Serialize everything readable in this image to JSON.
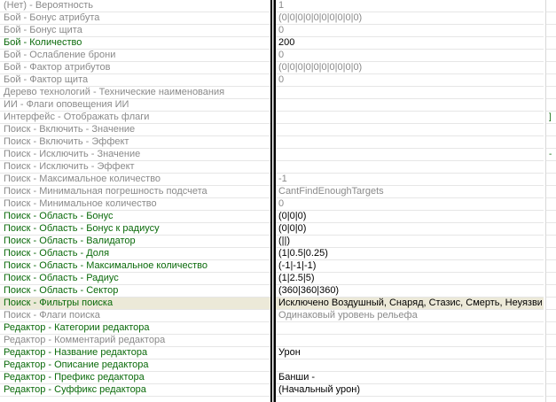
{
  "properties": [
    {
      "name": "(Нет) - Вероятность",
      "value": "1",
      "name_style": "gray",
      "value_style": "gray"
    },
    {
      "name": "Бой - Бонус атрибута",
      "value": "(0|0|0|0|0|0|0|0|0|0)",
      "name_style": "gray",
      "value_style": "gray"
    },
    {
      "name": "Бой - Бонус щита",
      "value": "0",
      "name_style": "gray",
      "value_style": "gray"
    },
    {
      "name": "Бой - Количество",
      "value": "200",
      "name_style": "green",
      "value_style": "black"
    },
    {
      "name": "Бой - Ослабление брони",
      "value": "0",
      "name_style": "gray",
      "value_style": "gray"
    },
    {
      "name": "Бой - Фактор атрибутов",
      "value": "(0|0|0|0|0|0|0|0|0|0)",
      "name_style": "gray",
      "value_style": "gray"
    },
    {
      "name": "Бой - Фактор щита",
      "value": "0",
      "name_style": "gray",
      "value_style": "gray"
    },
    {
      "name": "Дерево технологий - Технические наименования",
      "value": "",
      "name_style": "gray",
      "value_style": "gray"
    },
    {
      "name": "ИИ - Флаги оповещения ИИ",
      "value": "",
      "name_style": "gray",
      "value_style": "gray"
    },
    {
      "name": "Интерфейс - Отображать флаги",
      "value": "",
      "name_style": "gray",
      "value_style": "gray"
    },
    {
      "name": "Поиск - Включить - Значение",
      "value": "",
      "name_style": "gray",
      "value_style": "gray"
    },
    {
      "name": "Поиск - Включить - Эффект",
      "value": "",
      "name_style": "gray",
      "value_style": "gray"
    },
    {
      "name": "Поиск - Исключить - Значение",
      "value": "",
      "name_style": "gray",
      "value_style": "gray"
    },
    {
      "name": "Поиск - Исключить - Эффект",
      "value": "",
      "name_style": "gray",
      "value_style": "gray"
    },
    {
      "name": "Поиск - Максимальное количество",
      "value": "-1",
      "name_style": "gray",
      "value_style": "gray"
    },
    {
      "name": "Поиск - Минимальная погрешность подсчета",
      "value": "CantFindEnoughTargets",
      "name_style": "gray",
      "value_style": "gray"
    },
    {
      "name": "Поиск - Минимальное количество",
      "value": "0",
      "name_style": "gray",
      "value_style": "gray"
    },
    {
      "name": "Поиск - Область - Бонус",
      "value": "(0|0|0)",
      "name_style": "green",
      "value_style": "black"
    },
    {
      "name": "Поиск - Область - Бонус к радиусу",
      "value": "(0|0|0)",
      "name_style": "green",
      "value_style": "black"
    },
    {
      "name": "Поиск - Область - Валидатор",
      "value": "(||)",
      "name_style": "green",
      "value_style": "black"
    },
    {
      "name": "Поиск - Область - Доля",
      "value": "(1|0.5|0.25)",
      "name_style": "green",
      "value_style": "black"
    },
    {
      "name": "Поиск - Область - Максимальное количество",
      "value": "(-1|-1|-1)",
      "name_style": "green",
      "value_style": "black"
    },
    {
      "name": "Поиск - Область - Радиус",
      "value": "(1|2.5|5)",
      "name_style": "green",
      "value_style": "black"
    },
    {
      "name": "Поиск - Область - Сектор",
      "value": "(360|360|360)",
      "name_style": "green",
      "value_style": "black"
    },
    {
      "name": "Поиск - Фильтры поиска",
      "value": "Исключено Воздушный, Снаряд, Стазис, Смерть, Неуязви",
      "name_style": "green",
      "value_style": "black",
      "selected": true
    },
    {
      "name": "Поиск - Флаги поиска",
      "value": "Одинаковый уровень рельефа",
      "name_style": "gray",
      "value_style": "gray"
    },
    {
      "name": "Редактор - Категории редактора",
      "value": "",
      "name_style": "green",
      "value_style": "black"
    },
    {
      "name": "Редактор - Комментарий редактора",
      "value": "",
      "name_style": "gray",
      "value_style": "gray"
    },
    {
      "name": "Редактор - Название редактора",
      "value": "Урон",
      "name_style": "green",
      "value_style": "black"
    },
    {
      "name": "Редактор - Описание редактора",
      "value": "",
      "name_style": "green",
      "value_style": "black"
    },
    {
      "name": "Редактор - Префикс редактора",
      "value": "Банши -",
      "name_style": "green",
      "value_style": "black"
    },
    {
      "name": "Редактор - Суффикс редактора",
      "value": "(Начальный урон)",
      "name_style": "green",
      "value_style": "black"
    }
  ],
  "side_panel": {
    "marks": [
      {
        "row": 9,
        "text": "]"
      },
      {
        "row": 12,
        "text": "-"
      }
    ]
  },
  "colors": {
    "modified_name": "#0a6a0a",
    "default_text": "#8a8a8a",
    "modified_value": "#000000",
    "selected_row_bg": "#ece9d8"
  }
}
